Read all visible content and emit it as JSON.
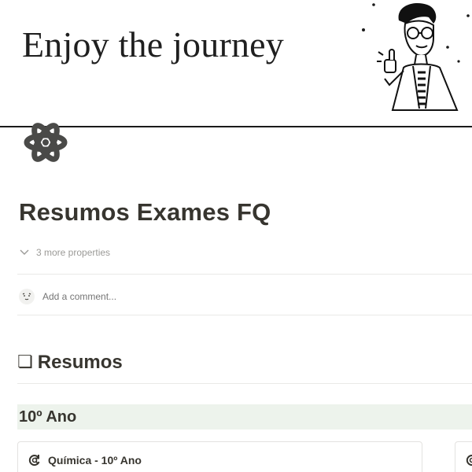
{
  "cover": {
    "text": "Enjoy the journey",
    "illustration": "person-thumbs-up-illustration"
  },
  "page": {
    "icon": "atom-icon",
    "title": "Resumos Exames FQ"
  },
  "properties": {
    "toggle_label": "3 more properties"
  },
  "comment": {
    "placeholder": "Add a comment..."
  },
  "resumos": {
    "glyph": "❏",
    "title": "Resumos",
    "groups": [
      {
        "heading": "10º Ano",
        "heading_color": "#edf3ec",
        "cards": [
          {
            "title": "Química - 10º Ano",
            "icon": "refresh-search-icon"
          }
        ]
      }
    ]
  }
}
